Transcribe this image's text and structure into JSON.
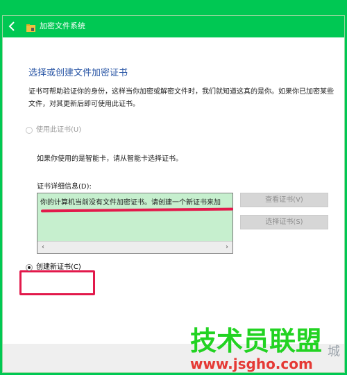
{
  "window": {
    "title": "加密文件系统"
  },
  "page": {
    "heading": "选择或创建文件加密证书",
    "description": "证书可帮助验证你的身份，这样当你加密或解密文件时，我们就知道这真的是你。如果你已加密某些文件，对其更新后即可使用此证书。",
    "use_cert_label": "使用此证书(U)",
    "smartcard_text": "如果你使用的是智能卡，请从智能卡选择证书。",
    "details_label": "证书详细信息(D):",
    "details_text": "你的计算机当前没有文件加密证书。请创建一个新证书来加",
    "view_button": "查看证书(V)",
    "select_button": "选择证书(S)",
    "create_cert_label": "创建新证书(C)"
  },
  "watermark": {
    "main": "技术员联盟",
    "url": "www.jsgho.com",
    "city": "城"
  },
  "icons": {
    "back": "back-arrow-icon",
    "app": "folder-lock-icon",
    "scroll_left": "scroll-left-icon",
    "scroll_right": "scroll-right-icon"
  },
  "colors": {
    "accent": "#00c853",
    "heading": "#2b57a6",
    "highlight": "#e2194b",
    "details_bg": "#c6efce"
  }
}
